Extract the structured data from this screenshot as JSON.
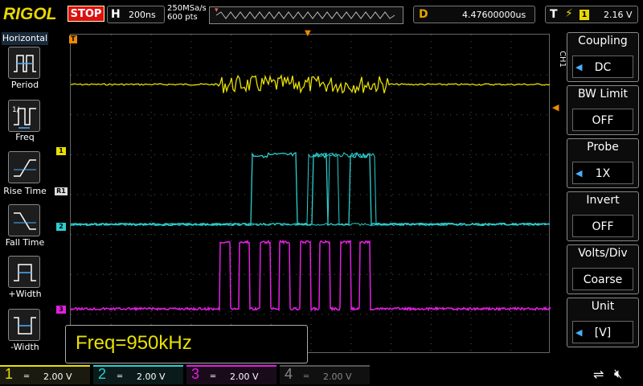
{
  "header": {
    "brand": "RIGOL",
    "run_state": "STOP",
    "timebase_key": "H",
    "timebase_value": "200ns",
    "sample_rate": "250MSa/s",
    "memory_depth": "600 pts",
    "delay_key": "D",
    "delay_value": "4.47600000us",
    "trigger_key": "T",
    "trigger_channel": "1",
    "trigger_level": "2.16 V"
  },
  "left_menu": {
    "title": "Horizontal",
    "items": [
      {
        "label": "Period",
        "icon": "period-icon"
      },
      {
        "label": "Freq",
        "icon": "freq-icon"
      },
      {
        "label": "Rise Time",
        "icon": "rise-time-icon"
      },
      {
        "label": "Fall Time",
        "icon": "fall-time-icon"
      },
      {
        "label": "+Width",
        "icon": "positive-width-icon"
      },
      {
        "label": "-Width",
        "icon": "negative-width-icon"
      }
    ]
  },
  "right_menu": {
    "channel_tag": "CH1",
    "items": [
      {
        "title": "Coupling",
        "value": "DC",
        "arrow": true
      },
      {
        "title": "BW Limit",
        "value": "OFF",
        "arrow": false
      },
      {
        "title": "Probe",
        "value": "1X",
        "arrow": true
      },
      {
        "title": "Invert",
        "value": "OFF",
        "arrow": false
      },
      {
        "title": "Volts/Div",
        "value": "Coarse",
        "arrow": false
      },
      {
        "title": "Unit",
        "value": "[V]",
        "arrow": true
      }
    ]
  },
  "measurement": {
    "text": "Freq=950kHz"
  },
  "channels": [
    {
      "num": "1",
      "scale": "2.00 V",
      "color": "#e8e000",
      "active": true
    },
    {
      "num": "2",
      "scale": "2.00 V",
      "color": "#2bd0d0",
      "active": true
    },
    {
      "num": "3",
      "scale": "2.00 V",
      "color": "#e020e0",
      "active": true
    },
    {
      "num": "4",
      "scale": "2.00 V",
      "color": "#888888",
      "active": false
    }
  ],
  "markers": {
    "trigger_marker": "T",
    "ch1": "1",
    "ch2": "2",
    "ch3": "3",
    "ref": "R1"
  },
  "colors": {
    "ch1": "#e8e000",
    "ch2": "#2bd0d0",
    "ch3": "#e020e0",
    "trigger": "#f08a00",
    "stop": "#d11111"
  }
}
